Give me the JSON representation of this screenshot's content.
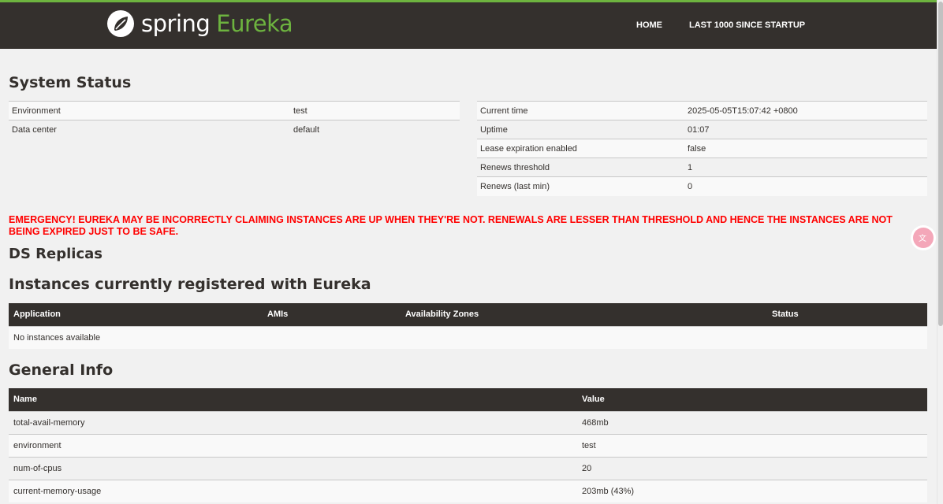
{
  "brand": {
    "spring": "spring",
    "eureka": "Eureka"
  },
  "nav": {
    "home": "HOME",
    "last1000": "LAST 1000 SINCE STARTUP"
  },
  "system_status": {
    "title": "System Status",
    "left": [
      {
        "key": "Environment",
        "value": "test"
      },
      {
        "key": "Data center",
        "value": "default"
      }
    ],
    "right": [
      {
        "key": "Current time",
        "value": "2025-05-05T15:07:42 +0800"
      },
      {
        "key": "Uptime",
        "value": "01:07"
      },
      {
        "key": "Lease expiration enabled",
        "value": "false"
      },
      {
        "key": "Renews threshold",
        "value": "1"
      },
      {
        "key": "Renews (last min)",
        "value": "0"
      }
    ]
  },
  "emergency": "EMERGENCY! EUREKA MAY BE INCORRECTLY CLAIMING INSTANCES ARE UP WHEN THEY'RE NOT. RENEWALS ARE LESSER THAN THRESHOLD AND HENCE THE INSTANCES ARE NOT BEING EXPIRED JUST TO BE SAFE.",
  "ds_replicas": {
    "title": "DS Replicas"
  },
  "instances": {
    "title": "Instances currently registered with Eureka",
    "columns": [
      "Application",
      "AMIs",
      "Availability Zones",
      "Status"
    ],
    "empty": "No instances available"
  },
  "general_info": {
    "title": "General Info",
    "columns": [
      "Name",
      "Value"
    ],
    "rows": [
      {
        "name": "total-avail-memory",
        "value": "468mb"
      },
      {
        "name": "environment",
        "value": "test"
      },
      {
        "name": "num-of-cpus",
        "value": "20"
      },
      {
        "name": "current-memory-usage",
        "value": "203mb (43%)"
      }
    ]
  },
  "icons": {
    "logo": "spring-leaf-icon",
    "translate": "translate-icon"
  },
  "colors": {
    "navbar": "#34302d",
    "accent": "#6db33f",
    "emergency": "#ff0000"
  }
}
